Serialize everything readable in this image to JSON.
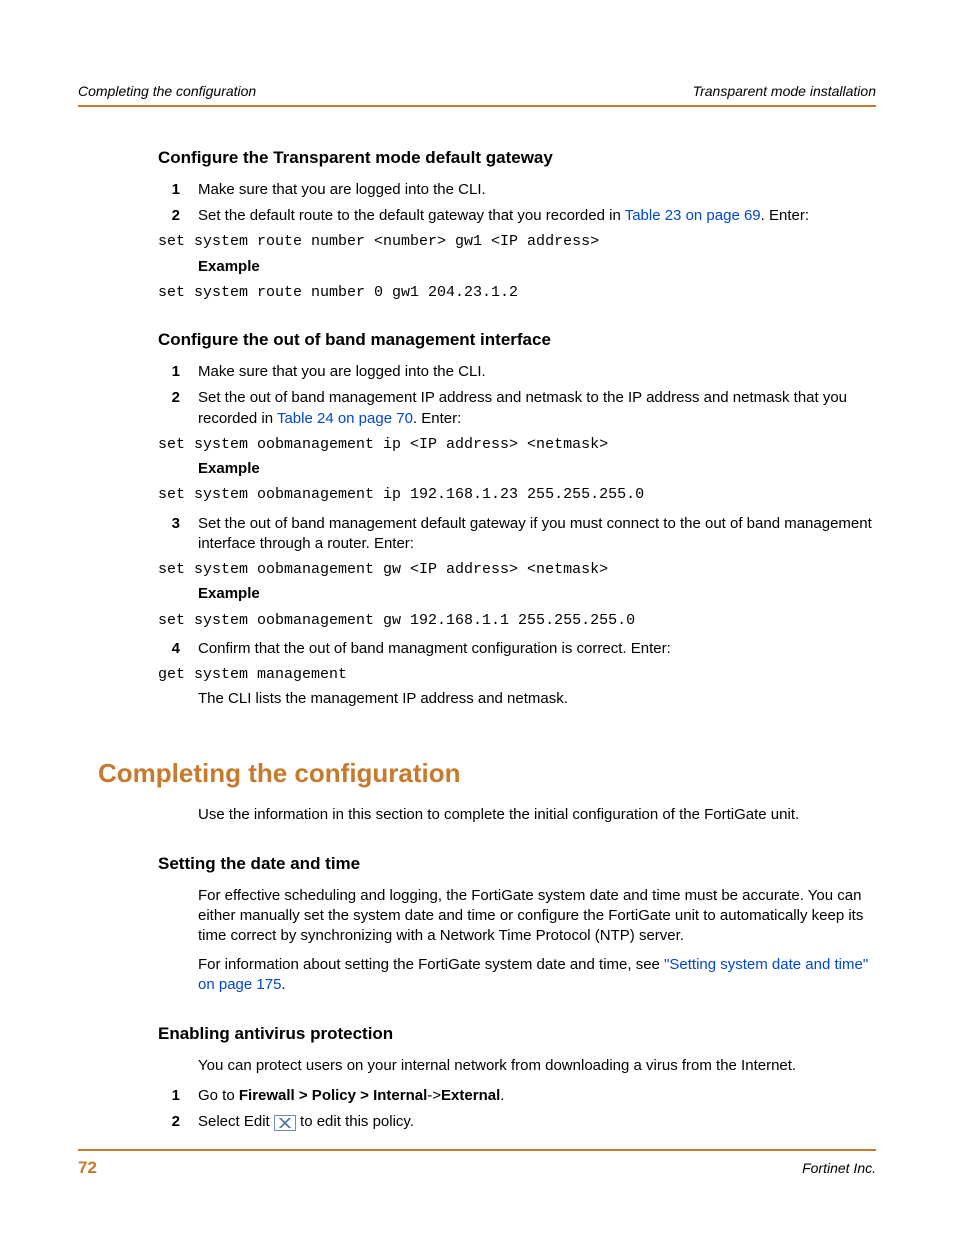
{
  "header": {
    "left": "Completing the configuration",
    "right": "Transparent mode installation"
  },
  "s1": {
    "title": "Configure the Transparent mode default gateway",
    "step1": "Make sure that you are logged into the CLI.",
    "step2a": "Set the default route to the default gateway that you recorded in ",
    "step2link": "Table 23 on page 69",
    "step2b": ". Enter:",
    "code1": "set system route number <number> gw1 <IP address>",
    "example": "Example",
    "code2": "set system route number 0 gw1 204.23.1.2"
  },
  "s2": {
    "title": "Configure the out of band management interface",
    "step1": "Make sure that you are logged into the CLI.",
    "step2a": "Set the out of band management IP address and netmask to the IP address and netmask that you recorded in ",
    "step2link": "Table 24 on page 70",
    "step2b": ". Enter:",
    "code1": "set system oobmanagement ip <IP address> <netmask>",
    "example": "Example",
    "code2": "set system oobmanagement ip 192.168.1.23 255.255.255.0",
    "step3": "Set the out of band management default gateway if you must connect to the out of band management interface through a router. Enter:",
    "code3": "set system oobmanagement gw <IP address> <netmask>",
    "code4": "set system oobmanagement gw 192.168.1.1 255.255.255.0",
    "step4": "Confirm that the out of band managment configuration is correct. Enter:",
    "code5": "get system management",
    "step4b": "The CLI lists the management IP address and netmask."
  },
  "s3": {
    "title": "Completing the configuration",
    "intro": "Use the information in this section to complete the initial configuration of the FortiGate unit."
  },
  "s4": {
    "title": "Setting the date and time",
    "p1": "For effective scheduling and logging, the FortiGate system date and time must be accurate. You can either manually set the system date and time or configure the FortiGate unit to automatically keep its time correct by synchronizing with a Network Time Protocol (NTP) server.",
    "p2a": "For information about setting the FortiGate system date and time, see ",
    "p2link": "\"Setting system date and time\" on page 175",
    "p2b": "."
  },
  "s5": {
    "title": "Enabling antivirus protection",
    "p1": "You can protect users on your internal network from downloading a virus from the Internet.",
    "step1a": "Go to ",
    "step1b": "Firewall > Policy > Internal",
    "step1c": "->",
    "step1d": "External",
    "step1e": ".",
    "step2a": "Select Edit ",
    "step2b": " to edit this policy."
  },
  "footer": {
    "page": "72",
    "company": "Fortinet Inc."
  }
}
